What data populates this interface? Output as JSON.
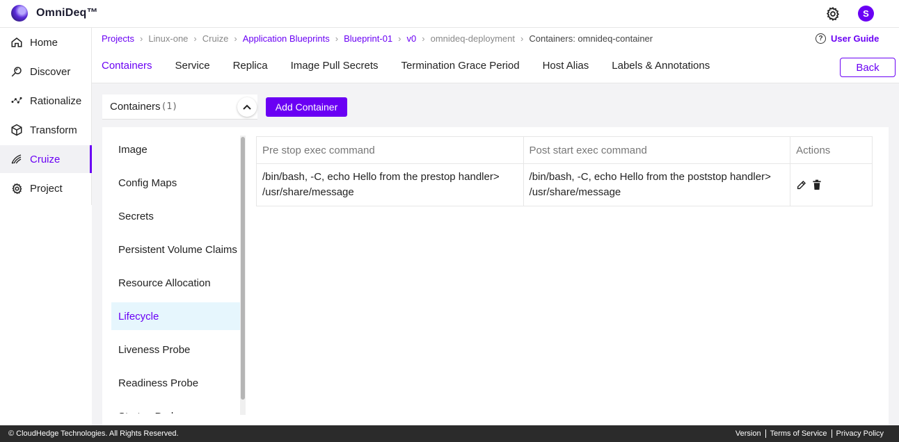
{
  "app": {
    "brand": "OmniDeq™",
    "avatar_initial": "S"
  },
  "sidebar": {
    "items": [
      {
        "label": "Home",
        "icon": "home-icon"
      },
      {
        "label": "Discover",
        "icon": "discover-icon"
      },
      {
        "label": "Rationalize",
        "icon": "rationalize-icon"
      },
      {
        "label": "Transform",
        "icon": "cube-icon"
      },
      {
        "label": "Cruize",
        "icon": "cruize-icon",
        "active": true
      },
      {
        "label": "Project",
        "icon": "gear-icon"
      }
    ]
  },
  "breadcrumb": {
    "items": [
      "Projects",
      "Linux-one",
      "Cruize",
      "Application Blueprints",
      "Blueprint-01",
      "v0",
      "omnideq-deployment",
      "Containers: omnideq-container"
    ]
  },
  "user_guide": "User Guide",
  "tabs": [
    "Containers",
    "Service",
    "Replica",
    "Image Pull Secrets",
    "Termination Grace Period",
    "Host Alias",
    "Labels & Annotations"
  ],
  "back_label": "Back",
  "containers": {
    "label": "Containers",
    "count": "(1)",
    "add_label": "Add Container"
  },
  "menu": {
    "items": [
      "Image",
      "Config Maps",
      "Secrets",
      "Persistent Volume Claims",
      "Resource Allocation",
      "Lifecycle",
      "Liveness Probe",
      "Readiness Probe",
      "Startup Probe"
    ],
    "active": "Lifecycle"
  },
  "table": {
    "headers": [
      "Pre stop exec command",
      "Post start exec command",
      "Actions"
    ],
    "rows": [
      {
        "pre_stop_1": "/bin/bash, -C, echo Hello from the prestop handler>",
        "pre_stop_2": "/usr/share/message",
        "post_start_1": "/bin/bash, -C, echo Hello from the poststop handler>",
        "post_start_2": "/usr/share/message"
      }
    ]
  },
  "footer": {
    "copyright": "© CloudHedge Technologies. All Rights Reserved.",
    "links": [
      "Version",
      "Terms of Service",
      "Privacy Policy"
    ]
  },
  "colors": {
    "accent": "#6a00f4",
    "active_row": "#e6f6fd",
    "footer_bg": "#2b2b2b"
  }
}
